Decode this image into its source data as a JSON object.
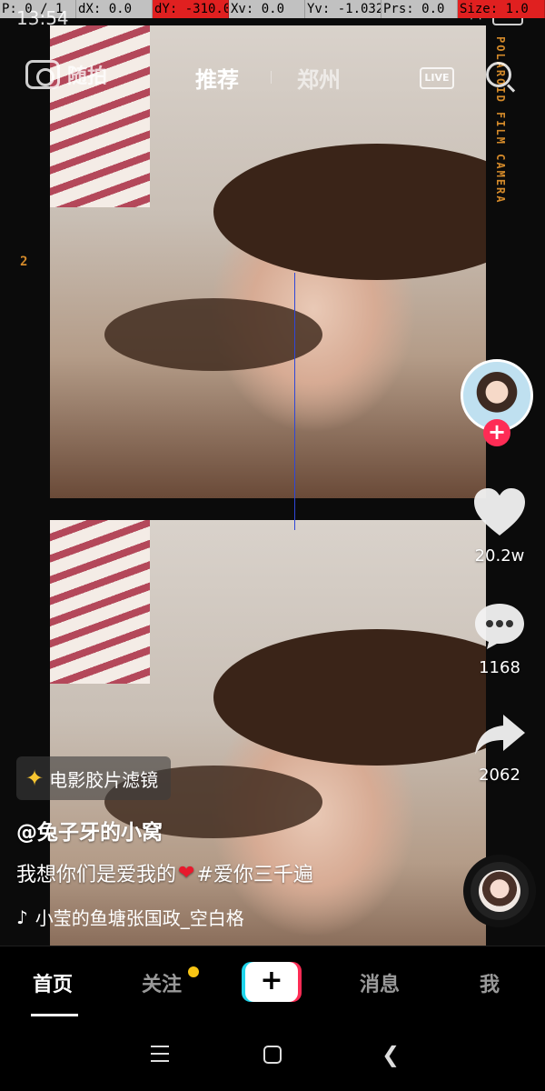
{
  "debug": {
    "p": "P: 0 / 1",
    "dx": "dX: 0.0",
    "dy": "dY: -310.0",
    "xv": "Xv: 0.0",
    "yv": "Yv: -1.032",
    "prs": "Prs: 0.0",
    "size": "Size: 1.0"
  },
  "status": {
    "time": "13:54"
  },
  "film": {
    "brand_text": "POLAROID FILM CAMERA",
    "frame_number": "2"
  },
  "top_nav": {
    "camera_label": "随拍",
    "tab_recommend": "推荐",
    "tab_local": "郑州",
    "live_label": "LIVE"
  },
  "actions": {
    "follow_plus": "+",
    "like_count": "20.2w",
    "comment_count": "1168",
    "share_count": "2062"
  },
  "post": {
    "filter_label": "电影胶片滤镜",
    "author": "@兔子牙的小窝",
    "caption_before": "我想你们是爱我的",
    "caption_hashtag": "#爱你三千遍",
    "music": "小莹的鱼塘张国政_空白格"
  },
  "tab_bar": {
    "home": "首页",
    "follow": "关注",
    "create": "+",
    "messages": "消息",
    "me": "我"
  },
  "colors": {
    "brand_red": "#fe2c55",
    "brand_cyan": "#20d5ec",
    "notification_dot": "#f8c514",
    "film_orange": "#d48a2a"
  }
}
